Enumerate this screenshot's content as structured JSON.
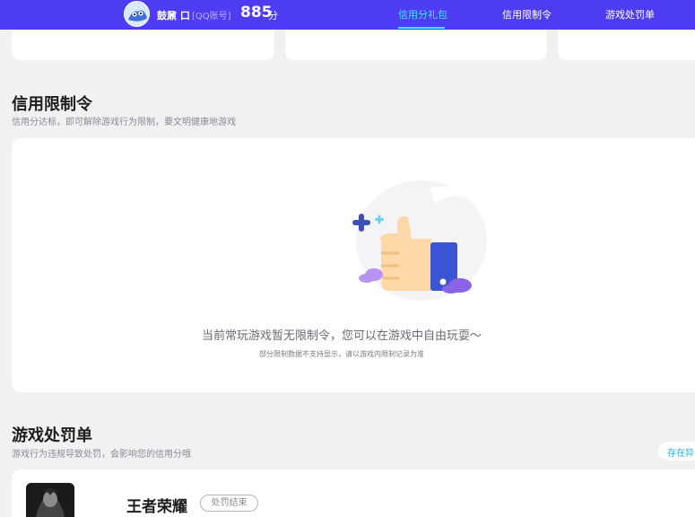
{
  "header": {
    "username": "鼓鼐 口",
    "account_type": "[QQ账号]",
    "score": "885",
    "score_unit": "分",
    "tabs": [
      {
        "label": "信用分礼包",
        "active": true
      },
      {
        "label": "信用限制令",
        "active": false
      },
      {
        "label": "游戏处罚单",
        "active": false
      }
    ]
  },
  "limits": {
    "title": "信用限制令",
    "subtitle": "信用分达标，即可解除游戏行为限制，要文明健康地游戏",
    "empty_message": "当前常玩游戏暂无限制令，您可以在游戏中自由玩耍～",
    "empty_note": "部分限制数据不支持显示，请以游戏内限制记录为准"
  },
  "penalties": {
    "title": "游戏处罚单",
    "subtitle": "游戏行为违规导致处罚，会影响您的信用分哦",
    "filter_pill": "存在异",
    "items": [
      {
        "game": "王者荣耀",
        "status": "处罚结束"
      }
    ]
  },
  "colors": {
    "header_bg": "#4e3cf2",
    "tab_active": "#46e4ff",
    "page_bg": "#f1f1f3"
  }
}
